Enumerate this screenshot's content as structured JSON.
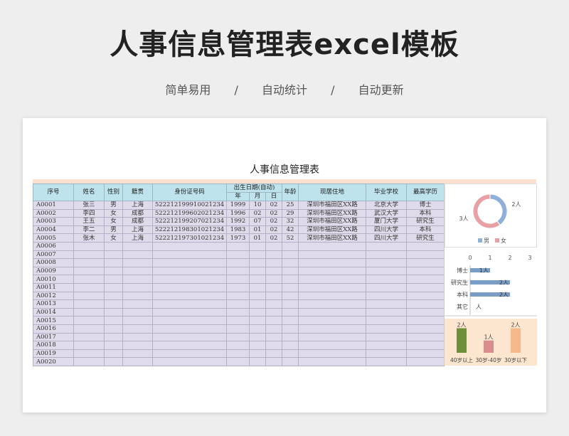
{
  "hero": {
    "title": "人事信息管理表excel模板",
    "tag1": "简单易用",
    "sep": "/",
    "tag2": "自动统计",
    "tag3": "自动更新"
  },
  "sheet": {
    "title": "人事信息管理表",
    "headers": {
      "seq": "序号",
      "name": "姓名",
      "gender": "性别",
      "origin": "籍贯",
      "id": "身份证号码",
      "birth": "出生日期(自动)",
      "year": "年",
      "month": "月",
      "day": "日",
      "age": "年龄",
      "address": "现居住地",
      "school": "毕业学校",
      "edu": "最高学历"
    },
    "rows": [
      {
        "seq": "A0001",
        "name": "张三",
        "gender": "男",
        "origin": "上海",
        "id": "522212199910021234",
        "year": "1999",
        "month": "10",
        "day": "02",
        "age": "25",
        "address": "深圳市福田区XX路",
        "school": "北京大学",
        "edu": "博士"
      },
      {
        "seq": "A0002",
        "name": "李四",
        "gender": "女",
        "origin": "成都",
        "id": "522212199602021234",
        "year": "1996",
        "month": "02",
        "day": "02",
        "age": "29",
        "address": "深圳市福田区XX路",
        "school": "武汉大学",
        "edu": "本科"
      },
      {
        "seq": "A0003",
        "name": "王五",
        "gender": "女",
        "origin": "成都",
        "id": "522212199207021234",
        "year": "1992",
        "month": "07",
        "day": "02",
        "age": "32",
        "address": "深圳市福田区XX路",
        "school": "厦门大学",
        "edu": "研究生"
      },
      {
        "seq": "A0004",
        "name": "李二",
        "gender": "男",
        "origin": "上海",
        "id": "522212198301021234",
        "year": "1983",
        "month": "01",
        "day": "02",
        "age": "42",
        "address": "深圳市福田区XX路",
        "school": "四川大学",
        "edu": "本科"
      },
      {
        "seq": "A0005",
        "name": "张木",
        "gender": "女",
        "origin": "上海",
        "id": "522212197301021234",
        "year": "1973",
        "month": "01",
        "day": "02",
        "age": "52",
        "address": "深圳市福田区XX路",
        "school": "四川大学",
        "edu": "研究生"
      },
      {
        "seq": "A0006"
      },
      {
        "seq": "A0007"
      },
      {
        "seq": "A0008"
      },
      {
        "seq": "A0009"
      },
      {
        "seq": "A0010"
      },
      {
        "seq": "A0011"
      },
      {
        "seq": "A0012"
      },
      {
        "seq": "A0013"
      },
      {
        "seq": "A0014"
      },
      {
        "seq": "A0015"
      },
      {
        "seq": "A0016"
      },
      {
        "seq": "A0017"
      },
      {
        "seq": "A0018"
      },
      {
        "seq": "A0019"
      },
      {
        "seq": "A0020"
      }
    ]
  },
  "chart_data": [
    {
      "type": "pie",
      "title": "",
      "categories": [
        "男",
        "女"
      ],
      "values": [
        2,
        3
      ],
      "data_labels": [
        "2人",
        "3人"
      ],
      "colors": [
        "#8fb0d8",
        "#e9a0a4"
      ],
      "legend": "bottom"
    },
    {
      "type": "bar",
      "orientation": "horizontal",
      "title": "",
      "categories": [
        "博士",
        "研究生",
        "本科",
        "其它"
      ],
      "values": [
        1,
        2,
        2,
        0
      ],
      "data_labels": [
        "1人",
        "2人",
        "2人",
        "人"
      ],
      "xlim": [
        0,
        3
      ],
      "xticks": [
        "0",
        "1",
        "2",
        "3"
      ],
      "color": "#7a9dc6"
    },
    {
      "type": "bar",
      "title": "",
      "categories": [
        "40岁以上",
        "30岁-40岁",
        "30岁以下"
      ],
      "values": [
        2,
        1,
        2
      ],
      "data_labels": [
        "2人",
        "1人",
        "2人"
      ],
      "colors": [
        "#6e8f3a",
        "#d98d8d",
        "#f6b98a"
      ],
      "ylim": [
        0,
        2.2
      ]
    }
  ]
}
